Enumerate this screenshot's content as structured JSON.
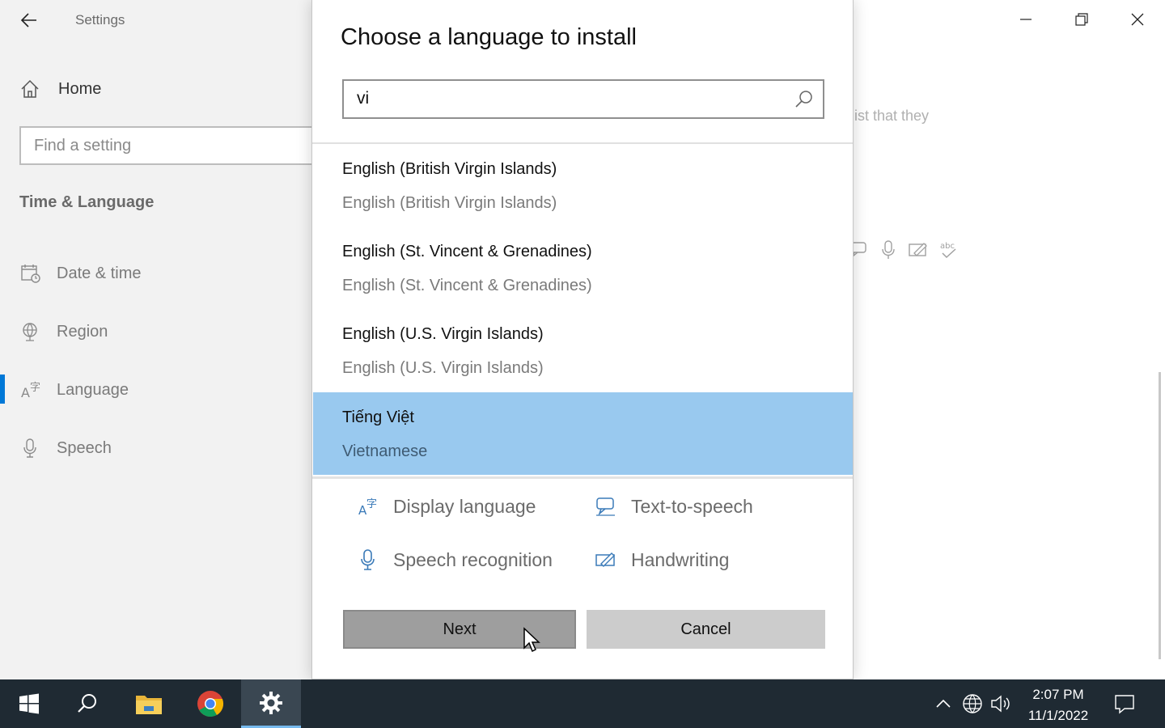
{
  "window": {
    "app_title": "Settings",
    "controls": [
      "minimize",
      "restore",
      "close"
    ]
  },
  "sidebar": {
    "home_label": "Home",
    "search_placeholder": "Find a setting",
    "section_title": "Time & Language",
    "items": [
      {
        "label": "Date & time",
        "icon": "calendar-clock-icon"
      },
      {
        "label": "Region",
        "icon": "globe-icon"
      },
      {
        "label": "Language",
        "icon": "language-icon",
        "active": true
      },
      {
        "label": "Speech",
        "icon": "microphone-icon"
      }
    ]
  },
  "background": {
    "partial_text": "ist that they"
  },
  "dialog": {
    "title": "Choose a language to install",
    "search_value": "vi",
    "languages": [
      {
        "name": "English (British Virgin Islands)",
        "native": "English (British Virgin Islands)",
        "selected": false
      },
      {
        "name": "English (St. Vincent & Grenadines)",
        "native": "English (St. Vincent & Grenadines)",
        "selected": false
      },
      {
        "name": "English (U.S. Virgin Islands)",
        "native": "English (U.S. Virgin Islands)",
        "selected": false
      },
      {
        "name": "Tiếng Việt",
        "native": "Vietnamese",
        "selected": true
      }
    ],
    "features": [
      {
        "label": "Display language",
        "icon": "display-language-icon"
      },
      {
        "label": "Text-to-speech",
        "icon": "text-to-speech-icon"
      },
      {
        "label": "Speech recognition",
        "icon": "microphone-icon"
      },
      {
        "label": "Handwriting",
        "icon": "handwriting-icon"
      }
    ],
    "next_label": "Next",
    "cancel_label": "Cancel"
  },
  "taskbar": {
    "time": "2:07 PM",
    "date": "11/1/2022",
    "accent": "#76b9ed"
  }
}
